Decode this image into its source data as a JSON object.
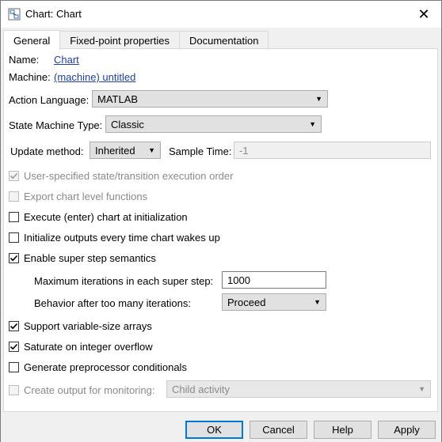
{
  "window": {
    "title": "Chart: Chart",
    "close_glyph": "✕"
  },
  "tabs": [
    {
      "label": "General",
      "active": true
    },
    {
      "label": "Fixed-point properties",
      "active": false
    },
    {
      "label": "Documentation",
      "active": false
    }
  ],
  "general": {
    "name_label": "Name:",
    "name_value": "Chart",
    "machine_label": "Machine:",
    "machine_value": "(machine) untitled",
    "action_language_label": "Action Language:",
    "action_language_value": "MATLAB",
    "state_machine_type_label": "State Machine Type:",
    "state_machine_type_value": "Classic",
    "update_method_label": "Update method:",
    "update_method_value": "Inherited",
    "sample_time_label": "Sample Time:",
    "sample_time_value": "-1",
    "checkboxes": [
      {
        "label": "User-specified state/transition execution order",
        "checked": true,
        "enabled": false
      },
      {
        "label": "Export chart level functions",
        "checked": false,
        "enabled": false
      },
      {
        "label": "Execute (enter) chart at initialization",
        "checked": false,
        "enabled": true
      },
      {
        "label": "Initialize outputs every time chart wakes up",
        "checked": false,
        "enabled": true
      },
      {
        "label": "Enable super step semantics",
        "checked": true,
        "enabled": true
      }
    ],
    "max_iterations_label": "Maximum iterations in each super step:",
    "max_iterations_value": "1000",
    "behavior_label": "Behavior after too many iterations:",
    "behavior_value": "Proceed",
    "checkboxes2": [
      {
        "label": "Support variable-size arrays",
        "checked": true,
        "enabled": true
      },
      {
        "label": "Saturate on integer overflow",
        "checked": true,
        "enabled": true
      },
      {
        "label": "Generate preprocessor conditionals",
        "checked": false,
        "enabled": true
      }
    ],
    "monitoring_label": "Create output for monitoring:",
    "monitoring_checked": false,
    "monitoring_value": "Child activity"
  },
  "buttons": {
    "ok": "OK",
    "cancel": "Cancel",
    "help": "Help",
    "apply": "Apply"
  },
  "colors": {
    "link": "#1d3fa8",
    "default_button_border": "#0078d7"
  },
  "icons": {
    "dropdown": "▼",
    "check": "check-icon",
    "app": "chart-app-icon"
  }
}
